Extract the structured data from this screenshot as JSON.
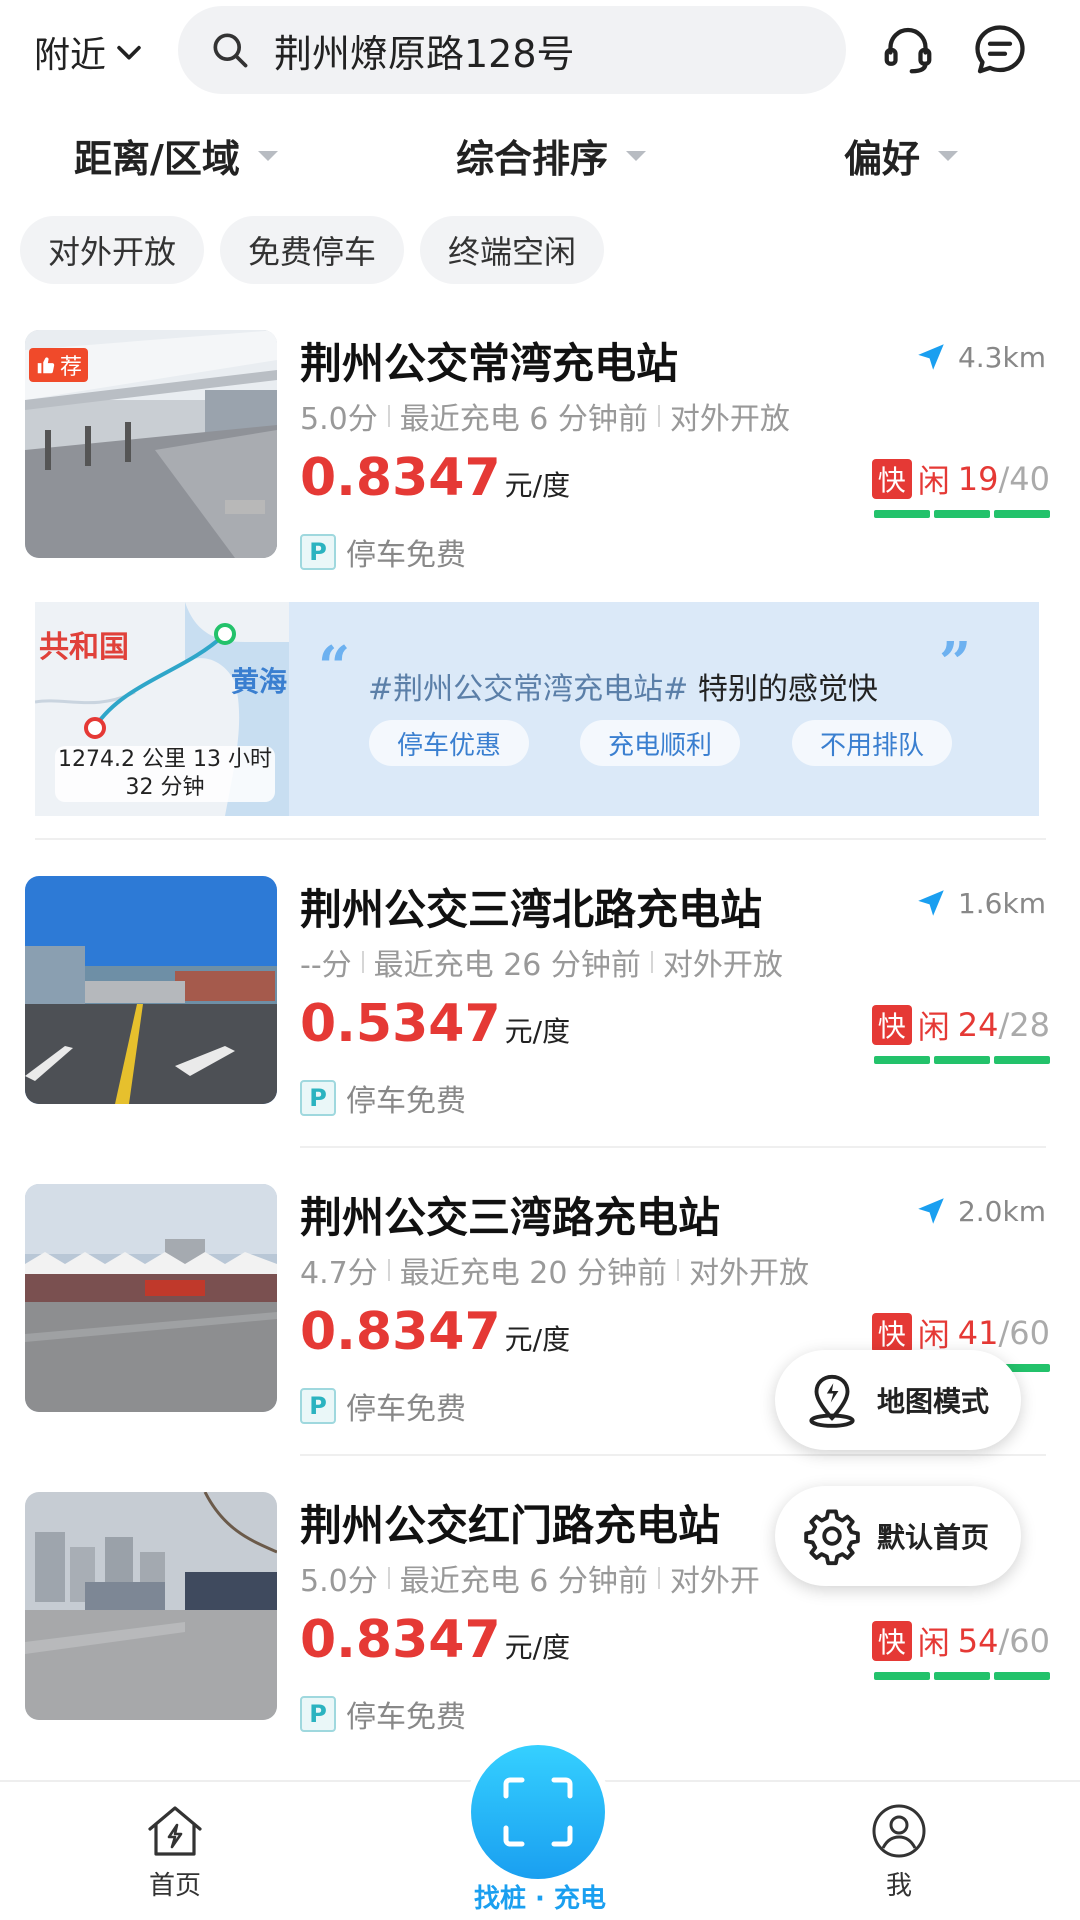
{
  "topbar": {
    "location_label": "附近",
    "search_value": "荆州燎原路128号"
  },
  "filters": [
    "距离/区域",
    "综合排序",
    "偏好"
  ],
  "chips": [
    "对外开放",
    "免费停车",
    "终端空闲"
  ],
  "stations": [
    {
      "badge": "荐",
      "name": "荆州公交常湾充电站",
      "distance": "4.3km",
      "rating": "5.0分",
      "last_charge": "最近充电 6 分钟前",
      "access": "对外开放",
      "price": "0.8347",
      "unit": "元/度",
      "parking_badge": "P",
      "parking": "停车免费",
      "fast_label": "快",
      "idle_label": "闲",
      "free": "19",
      "total": "/40"
    },
    {
      "name": "荆州公交三湾北路充电站",
      "distance": "1.6km",
      "rating": "--分",
      "last_charge": "最近充电 26 分钟前",
      "access": "对外开放",
      "price": "0.5347",
      "unit": "元/度",
      "parking_badge": "P",
      "parking": "停车免费",
      "fast_label": "快",
      "idle_label": "闲",
      "free": "24",
      "total": "/28"
    },
    {
      "name": "荆州公交三湾路充电站",
      "distance": "2.0km",
      "rating": "4.7分",
      "last_charge": "最近充电 20 分钟前",
      "access": "对外开放",
      "price": "0.8347",
      "unit": "元/度",
      "parking_badge": "P",
      "parking": "停车免费",
      "fast_label": "快",
      "idle_label": "闲",
      "free": "41",
      "total": "/60"
    },
    {
      "name": "荆州公交红门路充电站",
      "distance": "",
      "rating": "5.0分",
      "last_charge": "最近充电 6 分钟前",
      "access": "对外开",
      "price": "0.8347",
      "unit": "元/度",
      "parking_badge": "P",
      "parking": "停车免费",
      "fast_label": "快",
      "idle_label": "闲",
      "free": "54",
      "total": "/60"
    }
  ],
  "banner": {
    "map_country": "共和国",
    "map_sea": "黄海",
    "route": "1274.2 公里 13 小时 32 分钟",
    "quote_open": "“",
    "quote_close": "”",
    "hashtag": "#荆州公交常湾充电站#",
    "comment": " 特别的感觉快",
    "chips": [
      "停车优惠",
      "充电顺利",
      "不用排队"
    ]
  },
  "fabs": {
    "map_mode": "地图模式",
    "default_home": "默认首页"
  },
  "tabbar": {
    "home": "首页",
    "find": "找桩 · 充电",
    "me": "我"
  },
  "colors": {
    "price_red": "#e53935",
    "accent_blue": "#1a9ff0",
    "bar_green": "#23c26b"
  }
}
